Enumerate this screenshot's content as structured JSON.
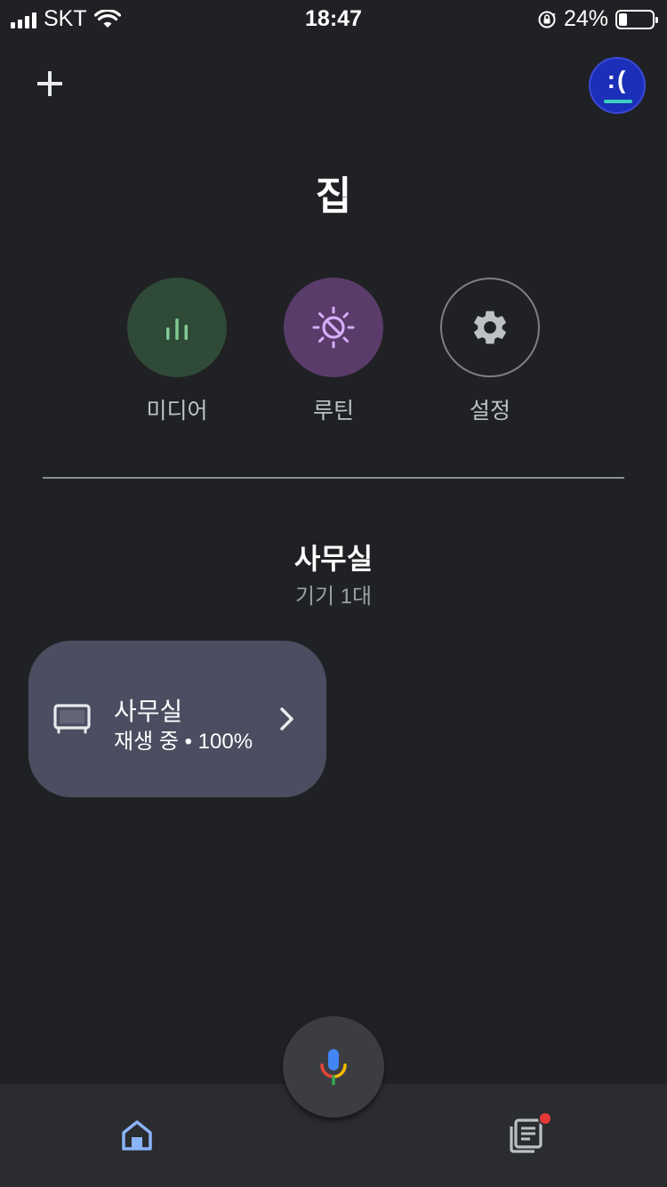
{
  "status_bar": {
    "carrier": "SKT",
    "time": "18:47",
    "battery_percent": "24%",
    "battery_level": 0.24,
    "icons": [
      "signal-icon",
      "wifi-icon",
      "rotation-lock-icon",
      "battery-icon"
    ]
  },
  "header": {
    "add_icon": "plus-icon",
    "avatar_text": ":(",
    "title": "집"
  },
  "shortcuts": [
    {
      "label": "미디어",
      "icon": "equalizer-icon",
      "color": "#2f4a37",
      "icon_color": "#81c995"
    },
    {
      "label": "루틴",
      "icon": "routine-sun-icon",
      "color": "#5a3c6a",
      "icon_color": "#d7aefb"
    },
    {
      "label": "설정",
      "icon": "gear-icon",
      "color": "transparent",
      "icon_color": "#bdc1c6"
    }
  ],
  "room": {
    "title": "사무실",
    "device_count": "기기 1대"
  },
  "device_card": {
    "icon": "tv-icon",
    "name": "사무실",
    "status": "재생 중 • 100%",
    "background": "#4a4e60"
  },
  "bottom_nav": {
    "home_icon": "home-icon",
    "mic_icon": "mic-icon",
    "feed_icon": "feed-icon",
    "feed_notification": true,
    "accent": "#8ab4f8"
  }
}
